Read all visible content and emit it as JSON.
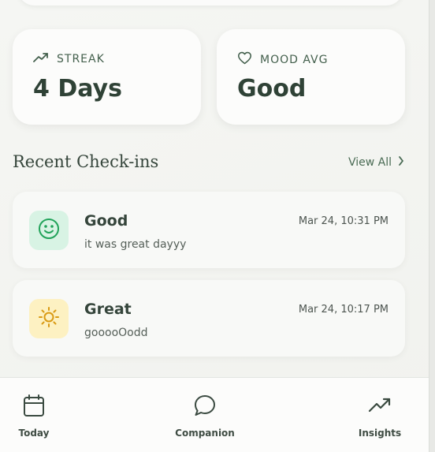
{
  "stats": {
    "streak": {
      "icon": "trending-up-icon",
      "label": "STREAK",
      "value": "4 Days"
    },
    "mood_avg": {
      "icon": "heart-icon",
      "label": "MOOD AVG",
      "value": "Good"
    }
  },
  "recent": {
    "title": "Recent Check-ins",
    "view_all_label": "View All",
    "items": [
      {
        "icon": "smiley-face-icon",
        "icon_bg": "#d8f3e4",
        "mood": "Good",
        "note": "it was great dayyy",
        "time": "Mar 24, 10:31 PM"
      },
      {
        "icon": "sun-icon",
        "icon_bg": "#fdf1c2",
        "mood": "Great",
        "note": "gooooOodd",
        "time": "Mar 24, 10:17 PM"
      }
    ]
  },
  "nav": {
    "items": [
      {
        "icon": "calendar-icon",
        "label": "Today"
      },
      {
        "icon": "chat-bubble-icon",
        "label": "Companion"
      },
      {
        "icon": "trending-up-icon",
        "label": "Insights"
      }
    ]
  },
  "colors": {
    "accent": "#44604d",
    "good_icon": "#22a35a",
    "great_icon": "#d99a14"
  }
}
